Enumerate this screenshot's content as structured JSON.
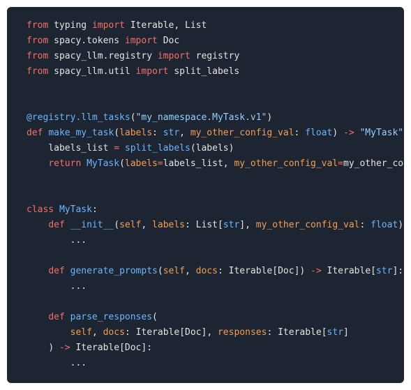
{
  "tokens": {
    "kw_from": "from",
    "kw_import": "import",
    "kw_def": "def",
    "kw_return": "return",
    "kw_class": "class",
    "op_arrow": "->",
    "op_eq": "=",
    "mod_typing": "typing",
    "imp_iterable_list": "Iterable, List",
    "mod_spacy_tokens": "spacy.tokens",
    "imp_doc": "Doc",
    "mod_spacy_llm_registry": "spacy_llm.registry",
    "imp_registry": "registry",
    "mod_spacy_llm_util": "spacy_llm.util",
    "imp_split_labels": "split_labels",
    "deco_base": "@registry.llm_tasks",
    "deco_arg": "\"my_namespace.MyTask.v1\"",
    "fn_make_my_task": "make_my_task",
    "p_labels": "labels",
    "t_str": "str",
    "p_other": "my_other_config_val",
    "t_float": "float",
    "ret_mytask": "\"MyTask\"",
    "var_labels_list": "labels_list",
    "call_split_labels": "split_labels",
    "cls_mytask": "MyTask",
    "kw_labels": "labels",
    "val_labels_list": "labels_list",
    "kw_other": "my_other_config_val",
    "val_other": "my_other_con",
    "cls_name": "MyTask",
    "fn_init": "__init__",
    "p_self": "self",
    "t_list": "List",
    "ellipsis": "...",
    "fn_generate_prompts": "generate_prompts",
    "p_docs": "docs",
    "t_iterable": "Iterable",
    "t_doc": "Doc",
    "fn_parse_responses": "parse_responses",
    "p_responses": "responses"
  }
}
